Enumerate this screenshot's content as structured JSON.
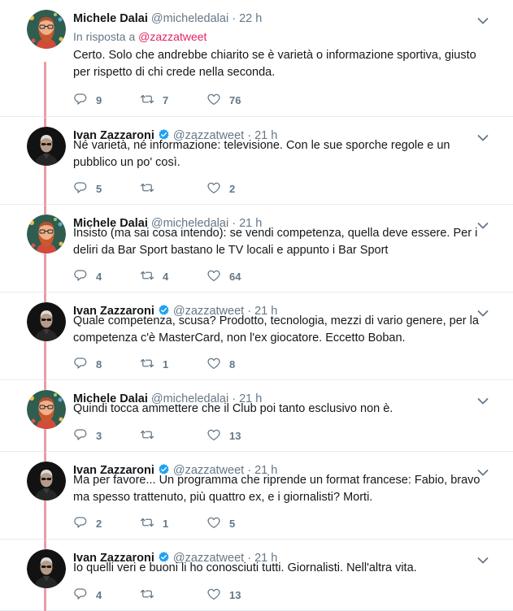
{
  "tweets": [
    {
      "name": "Michele Dalai",
      "handle": "@micheledalai",
      "dot": "·",
      "time": "22 h",
      "verified": false,
      "avatar": "michele",
      "reply_prefix": "In risposta a",
      "reply_mention": "@zazzatweet",
      "text": "Certo. Solo che andrebbe chiarito se è varietà o informazione sportiva, giusto per rispetto di chi crede nella seconda.",
      "replies": "9",
      "retweets": "7",
      "likes": "76"
    },
    {
      "name": "Ivan Zazzaroni",
      "handle": "@zazzatweet",
      "dot": "·",
      "time": "21 h",
      "verified": true,
      "avatar": "ivan",
      "text": "Né varietà, né informazione: televisione. Con le sue sporche regole e un pubblico un po' così.",
      "replies": "5",
      "retweets": "",
      "likes": "2"
    },
    {
      "name": "Michele Dalai",
      "handle": "@micheledalai",
      "dot": "·",
      "time": "21 h",
      "verified": false,
      "avatar": "michele",
      "text": "Insisto (ma sai cosa intendo): se vendi competenza, quella deve essere. Per i deliri da Bar Sport bastano le TV locali e appunto i Bar Sport",
      "replies": "4",
      "retweets": "4",
      "likes": "64"
    },
    {
      "name": "Ivan Zazzaroni",
      "handle": "@zazzatweet",
      "dot": "·",
      "time": "21 h",
      "verified": true,
      "avatar": "ivan",
      "text": "Quale competenza, scusa? Prodotto, tecnologia, mezzi di vario genere, per la competenza c'è MasterCard, non l'ex giocatore. Eccetto Boban.",
      "replies": "8",
      "retweets": "1",
      "likes": "8"
    },
    {
      "name": "Michele Dalai",
      "handle": "@micheledalai",
      "dot": "·",
      "time": "21 h",
      "verified": false,
      "avatar": "michele",
      "text": "Quindi tocca ammettere che il Club poi tanto esclusivo non è.",
      "replies": "3",
      "retweets": "",
      "likes": "13"
    },
    {
      "name": "Ivan Zazzaroni",
      "handle": "@zazzatweet",
      "dot": "·",
      "time": "21 h",
      "verified": true,
      "avatar": "ivan",
      "text": "Ma per favore... Un programma che riprende un format francese: Fabio, bravo ma spesso trattenuto, più quattro ex, e i giornalisti? Morti.",
      "replies": "2",
      "retweets": "1",
      "likes": "5"
    },
    {
      "name": "Ivan Zazzaroni",
      "handle": "@zazzatweet",
      "dot": "·",
      "time": "21 h",
      "verified": true,
      "avatar": "ivan",
      "text": "Io quelli veri e buoni li ho conosciuti tutti. Giornalisti. Nell'altra vita.",
      "replies": "4",
      "retweets": "",
      "likes": "13"
    }
  ],
  "colors": {
    "thread_line": "#ea9ca3",
    "mention": "#e0245e",
    "muted": "#657786",
    "verified": "#1da1f2"
  },
  "icons": {
    "reply": "reply-icon",
    "retweet": "retweet-icon",
    "like": "heart-icon",
    "caret": "chevron-down-icon",
    "verified": "verified-badge-icon"
  }
}
